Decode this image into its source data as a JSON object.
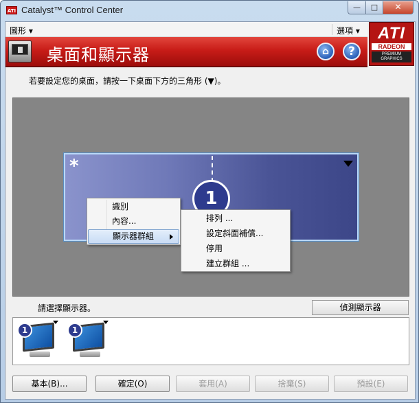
{
  "window": {
    "title": "Catalyst™ Control Center",
    "app_badge": "ATI",
    "controls": {
      "minimize": "—",
      "maximize": "□",
      "close": "✕"
    }
  },
  "menubar": {
    "graphics": "圖形 ▾",
    "options": "選項 ▾"
  },
  "banner": {
    "title": "桌面和顯示器",
    "home_icon": "⌂",
    "help_icon": "?"
  },
  "logo": {
    "brand": "ATI",
    "product": "RADEON",
    "line1": "PREMIUM",
    "line2": "GRAPHICS"
  },
  "instruction": "若要設定您的桌面，請按一下桌面下方的三角形 (▼)。",
  "desktop": {
    "primary_mark": "*",
    "monitor_number": "1"
  },
  "context_menu": {
    "items": [
      "識別",
      "內容...",
      "顯示器群組"
    ]
  },
  "submenu": {
    "items": [
      "排列 ...",
      "設定斜面補償...",
      "停用",
      "建立群組 ..."
    ]
  },
  "select_label": "請選擇顯示器。",
  "detect_button": "偵測顯示器",
  "thumbnails": [
    {
      "number": "1"
    },
    {
      "number": "1"
    }
  ],
  "buttons": {
    "basic": "基本(B)...",
    "ok": "確定(O)",
    "apply": "套用(A)",
    "discard": "捨棄(S)",
    "defaults": "預設(E)"
  },
  "colors": {
    "banner_red": "#c81c18",
    "monitor_blue": "#4a5496",
    "badge_blue": "#2e3b8e"
  }
}
